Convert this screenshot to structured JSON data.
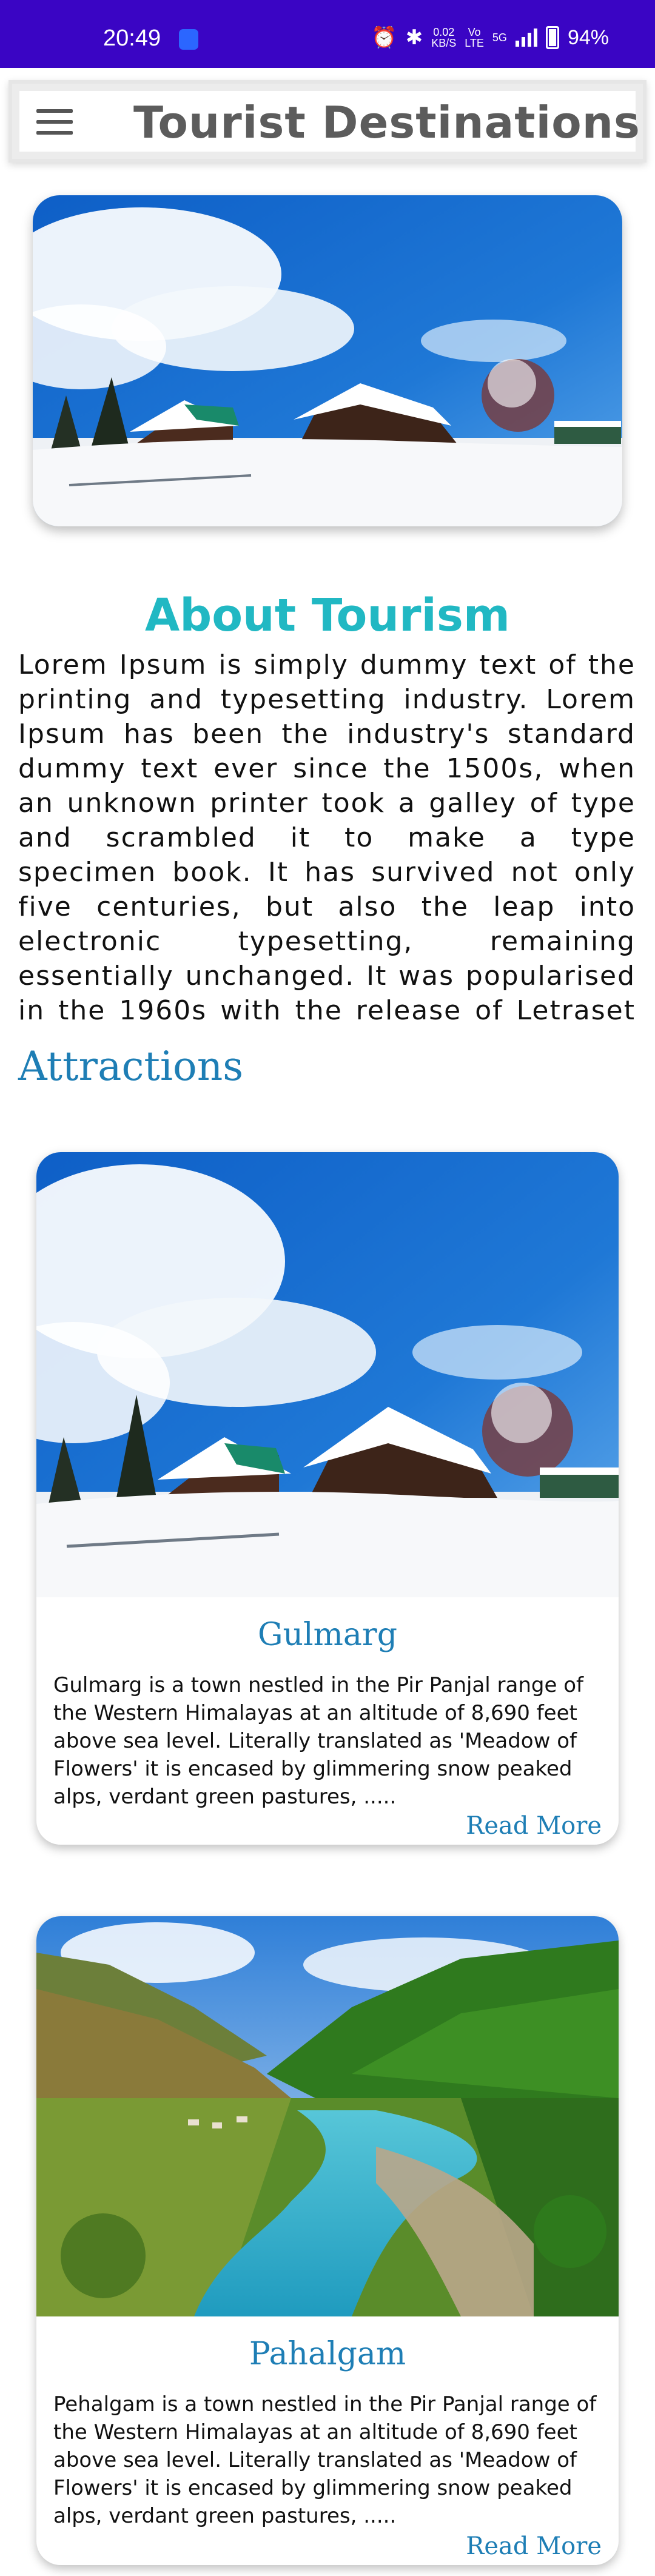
{
  "status_bar": {
    "time": "20:49",
    "net_speed_value": "0.02",
    "net_speed_unit": "KB/S",
    "volte_top": "Vo",
    "volte_bottom": "LTE",
    "network": "5G",
    "battery": "94%"
  },
  "app_bar": {
    "title": "Tourist Destinations"
  },
  "about": {
    "title": "About Tourism",
    "text": "Lorem Ipsum is simply dummy text of the printing and typesetting industry. Lorem Ipsum has been the industry's standard dummy text ever since the 1500s, when an unknown printer took a galley of type and scrambled it to make a type specimen book. It has survived not only five centuries, but also the leap into electronic typesetting, remaining essentially unchanged. It was popularised in the 1960s with the release of Letraset sheets containing Lorem"
  },
  "attractions": {
    "title": "Attractions",
    "items": [
      {
        "name": "Gulmarg",
        "description": "Gulmarg is a town nestled in the Pir Panjal range of the Western Himalayas at an altitude of 8,690 feet above sea level. Literally translated as 'Meadow of Flowers' it is encased by glimmering snow peaked alps, verdant green pastures, .....",
        "read_more": "Read More"
      },
      {
        "name": "Pahalgam",
        "description": "Pehalgam is a town nestled in the Pir Panjal range of the Western Himalayas at an altitude of 8,690 feet above sea level. Literally translated as 'Meadow of Flowers' it is encased by glimmering snow peaked alps, verdant green pastures, .....",
        "read_more": "Read More"
      }
    ]
  },
  "colors": {
    "status_bar": "#3a05c4",
    "accent_teal": "#21b8c3",
    "accent_blue": "#1e7eb5"
  }
}
